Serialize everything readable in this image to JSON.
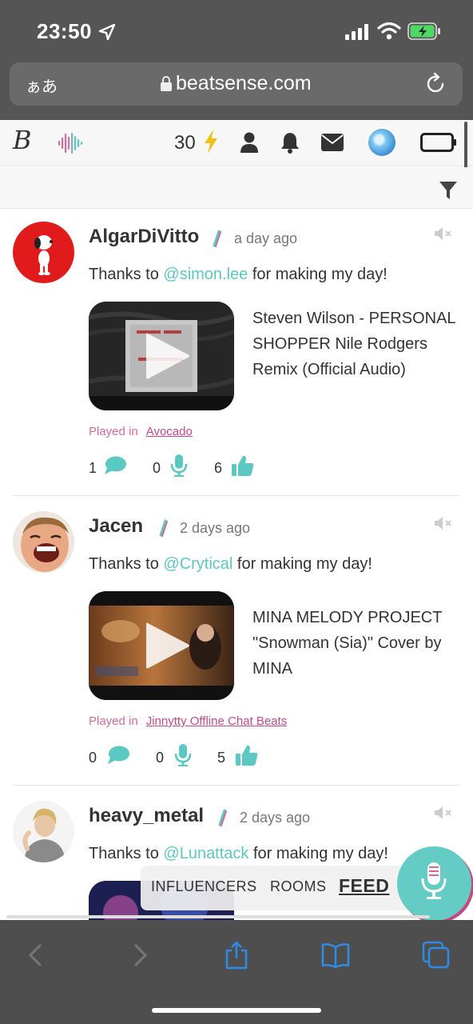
{
  "status_bar": {
    "time": "23:50"
  },
  "browser": {
    "aa_label": "ぁあ",
    "url": "beatsense.com"
  },
  "header": {
    "logo": "B",
    "points": "30"
  },
  "posts": [
    {
      "username": "AlgarDiVitto",
      "time": "a day ago",
      "message_prefix": "Thanks to ",
      "mention": "@simon.lee",
      "message_suffix": " for making my day!",
      "video_title": "Steven Wilson - PERSONAL SHOPPER Nile Rodgers Remix (Official Audio)",
      "played_in_label": "Played in",
      "room": "Avocado",
      "comments": "1",
      "mics": "0",
      "likes": "6"
    },
    {
      "username": "Jacen",
      "time": "2 days ago",
      "message_prefix": "Thanks to ",
      "mention": "@Crytical",
      "message_suffix": " for making my day!",
      "video_title": "MINA MELODY PROJECT \"Snowman (Sia)\" Cover by MINA",
      "played_in_label": "Played in",
      "room": "Jinnytty Offline Chat Beats",
      "comments": "0",
      "mics": "0",
      "likes": "5"
    },
    {
      "username": "heavy_metal",
      "time": "2 days ago",
      "message_prefix": "Thanks to ",
      "mention": "@Lunattack",
      "message_suffix": " for making my day!"
    }
  ],
  "nav": {
    "influencers": "INFLUENCERS",
    "rooms": "ROOMS",
    "feed": "FEED"
  },
  "colors": {
    "accent": "#5cc8c2",
    "pink": "#c44a84"
  }
}
